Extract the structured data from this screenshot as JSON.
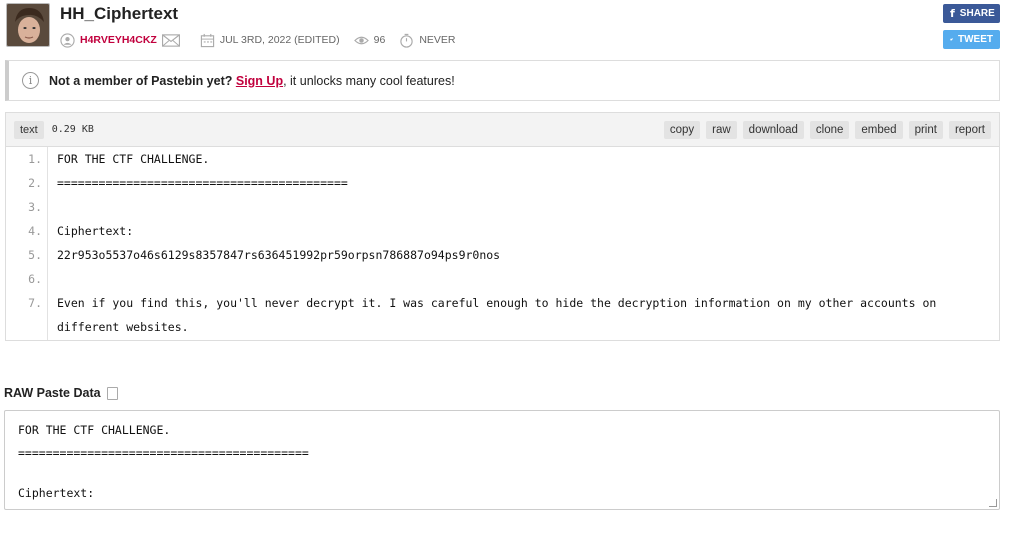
{
  "paste": {
    "title": "HH_Ciphertext",
    "author": "H4RVEYH4CKZ",
    "date": "JUL 3RD, 2022 (EDITED)",
    "views": "96",
    "expires": "NEVER"
  },
  "social": {
    "share": "SHARE",
    "tweet": "TWEET"
  },
  "notice": {
    "prefix": "Not a member of Pastebin yet?",
    "link": "Sign Up",
    "suffix": ", it unlocks many cool features!"
  },
  "code": {
    "syntax": "text",
    "size": "0.29 KB",
    "actions": [
      "copy",
      "raw",
      "download",
      "clone",
      "embed",
      "print",
      "report"
    ],
    "lines": [
      {
        "n": "1.",
        "t": "FOR THE CTF CHALLENGE."
      },
      {
        "n": "2.",
        "t": "=========================================="
      },
      {
        "n": "3.",
        "t": ""
      },
      {
        "n": "4.",
        "t": "Ciphertext:"
      },
      {
        "n": "5.",
        "t": "22r953o5537o46s6129s8357847rs636451992pr59orpsn786887o94ps9r0nos"
      },
      {
        "n": "6.",
        "t": ""
      },
      {
        "n": "7.",
        "t": "Even if you find this, you'll never decrypt it. I was careful enough to hide the decryption information on my other accounts on"
      },
      {
        "n": "",
        "t": "different websites."
      }
    ]
  },
  "raw": {
    "title": "RAW Paste Data",
    "lines": [
      "FOR THE CTF CHALLENGE.",
      "==========================================",
      "",
      "Ciphertext:"
    ]
  },
  "colors": {
    "accent": "#c1003d",
    "facebook": "#3b5998",
    "twitter": "#55acee"
  }
}
